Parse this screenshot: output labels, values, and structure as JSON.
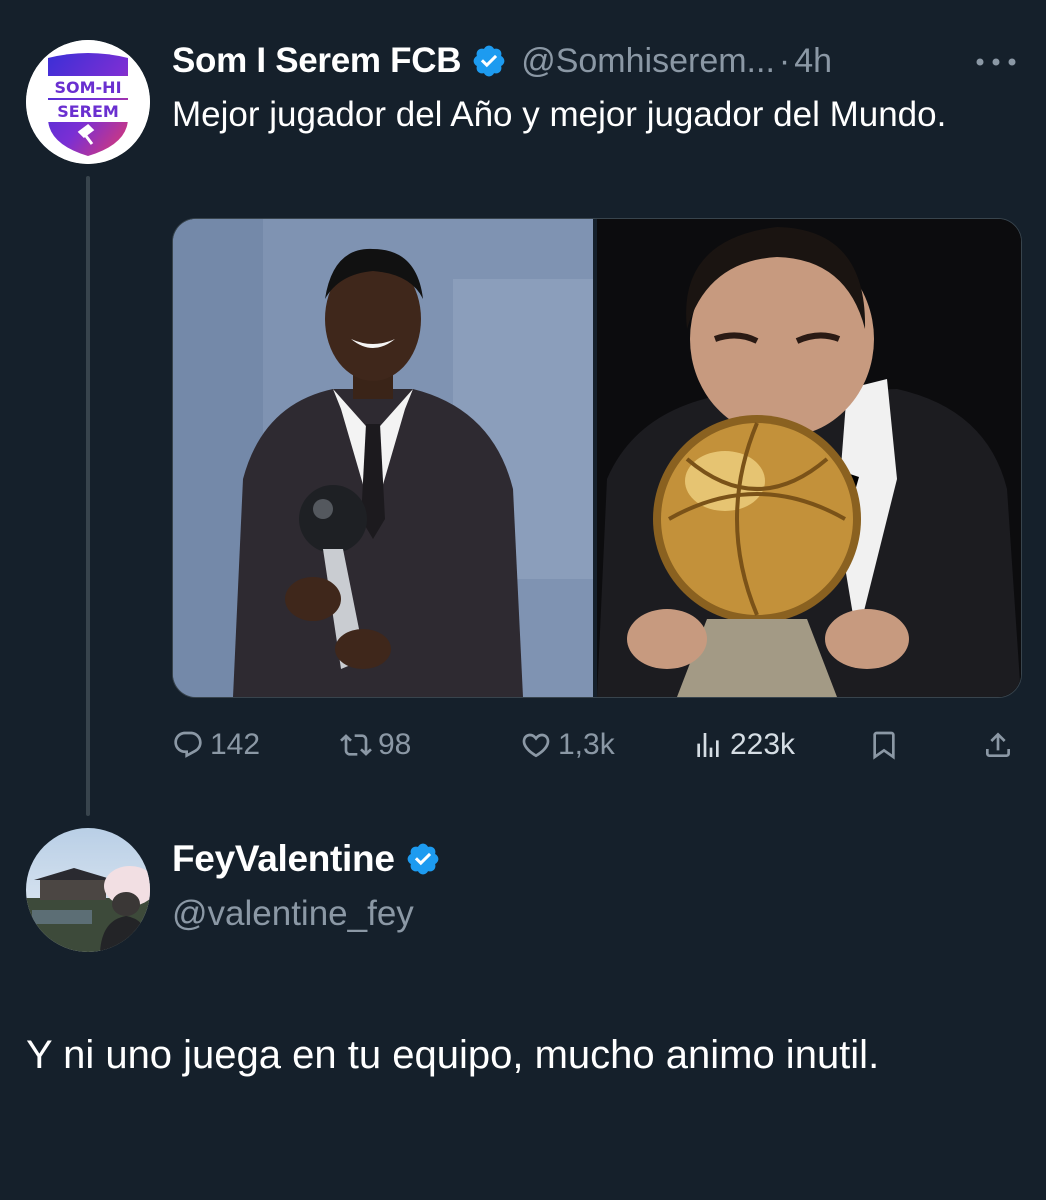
{
  "tweet": {
    "author": {
      "display_name": "Som I Serem FCB",
      "handle": "@Somhiserem...",
      "verified": true,
      "avatar_text_line1": "SOM-HI",
      "avatar_text_line2": "SEREM"
    },
    "separator": "·",
    "time": "4h",
    "text": "Mejor jugador del Año y mejor jugador del Mundo.",
    "stats": {
      "replies": "142",
      "reposts": "98",
      "likes": "1,3k",
      "views": "223k"
    },
    "media": [
      {
        "icon": "photo-award-left"
      },
      {
        "icon": "photo-award-right"
      }
    ]
  },
  "reply": {
    "author": {
      "display_name": "FeyValentine",
      "handle": "@valentine_fey",
      "verified": true
    },
    "text": "Y ni uno juega en tu equipo, mucho animo inutil."
  },
  "colors": {
    "background": "#15202b",
    "secondary_text": "#8b98a5",
    "verified_blue": "#1d9bf0",
    "divider": "#38444d"
  },
  "icons": {
    "reply": "reply-icon",
    "repost": "repost-icon",
    "like": "heart-icon",
    "views": "views-icon",
    "bookmark": "bookmark-icon",
    "share": "share-icon",
    "more": "more-icon",
    "verified": "verified-badge-icon"
  }
}
